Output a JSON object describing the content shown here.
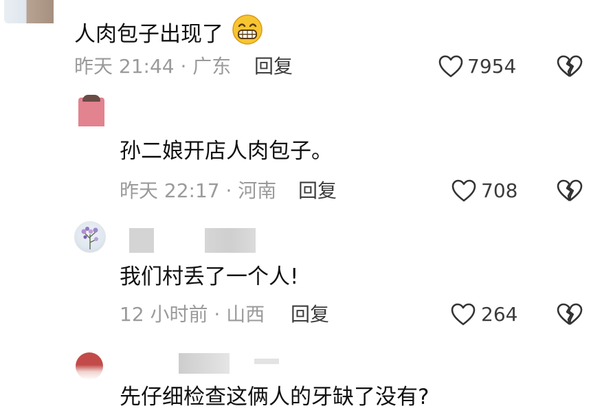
{
  "comments": [
    {
      "text": "人肉包子出现了",
      "emoji": "grinning-emoji",
      "time_location": "昨天 21:44 · 广东",
      "reply_label": "回复",
      "likes": "7954"
    },
    {
      "text": "孙二娘开店人肉包子。",
      "time_location": "昨天 22:17 · 河南",
      "reply_label": "回复",
      "likes": "708"
    },
    {
      "text": "我们村丢了一个人!",
      "time_location": "12 小时前 · 山西",
      "reply_label": "回复",
      "likes": "264"
    },
    {
      "text": "先仔细检查这俩人的牙缺了没有?"
    }
  ],
  "icons": {
    "like": "heart-outline-icon",
    "dislike": "broken-heart-icon"
  },
  "colors": {
    "text": "#111111",
    "meta": "#9a9a9a",
    "reply": "#3c3c3c",
    "emoji_face": "#f7c531"
  }
}
